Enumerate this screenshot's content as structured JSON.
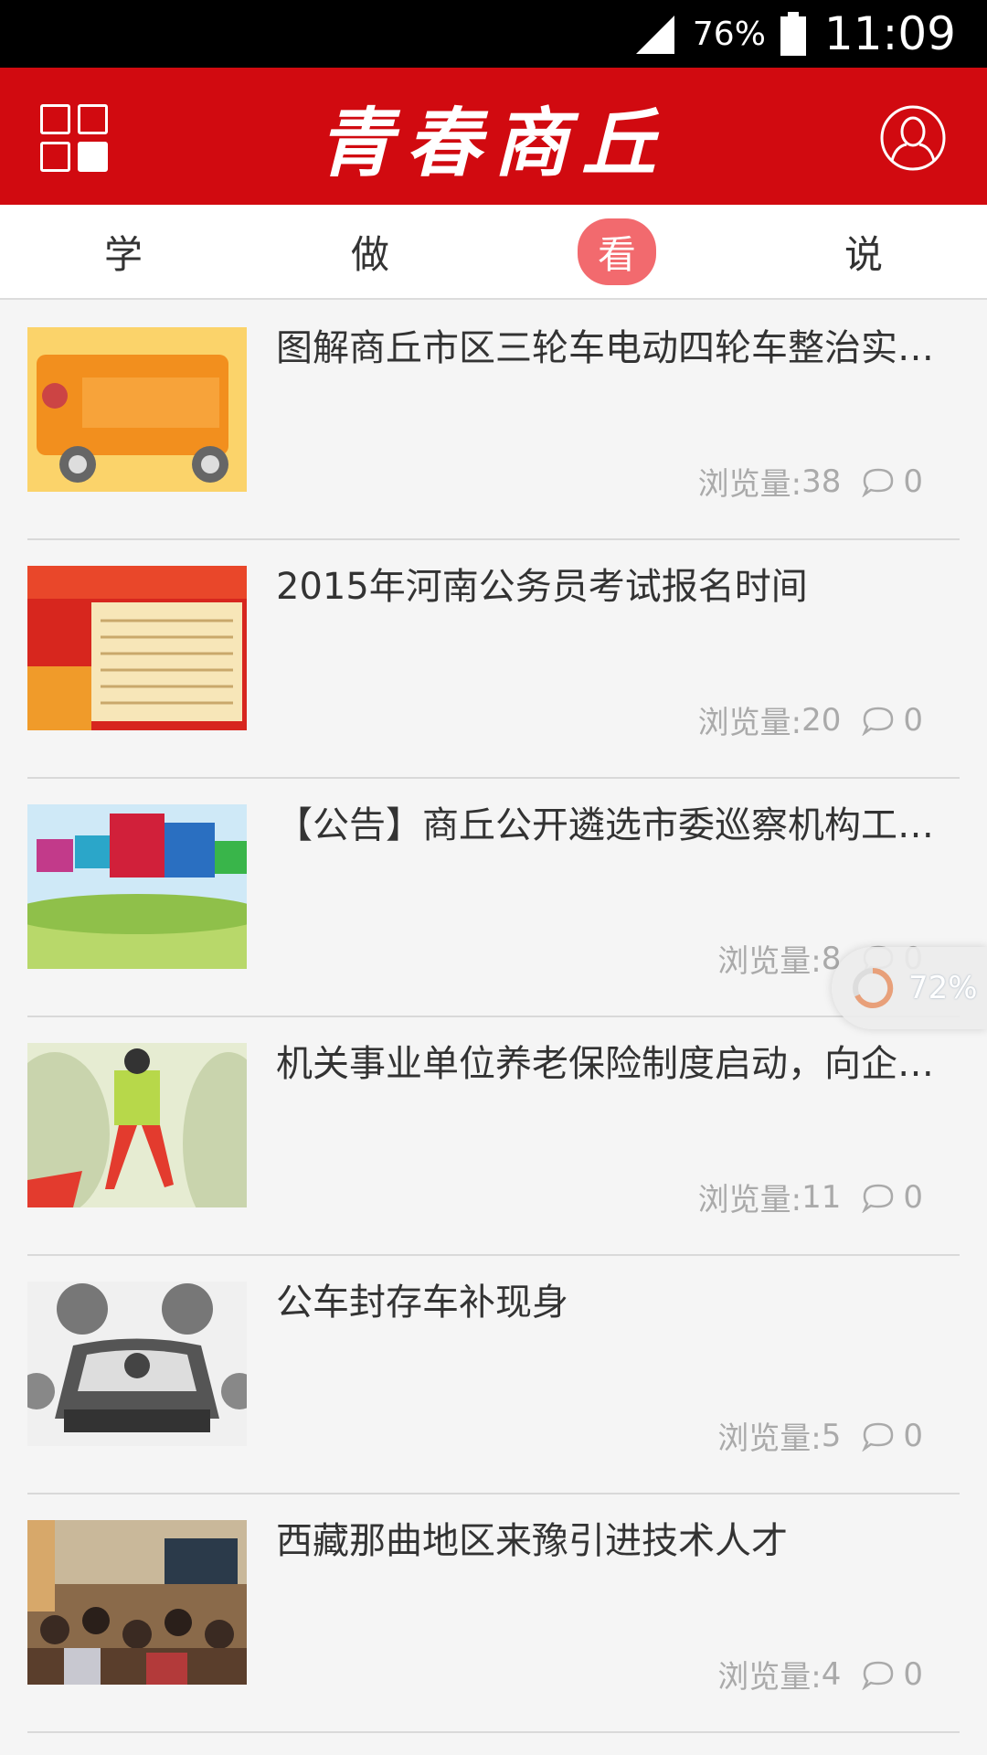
{
  "status_bar": {
    "battery": "76%",
    "time": "11:09"
  },
  "header": {
    "logo_text": "青春商丘"
  },
  "tabs": [
    {
      "label": "学",
      "active": false
    },
    {
      "label": "做",
      "active": false
    },
    {
      "label": "看",
      "active": true
    },
    {
      "label": "说",
      "active": false
    }
  ],
  "views_label": "浏览量:",
  "articles": [
    {
      "title": "图解商丘市区三轮车电动四轮车整治实施意见",
      "views": "38",
      "comments": "0",
      "image": "orange-truck-infographic"
    },
    {
      "title": "2015年河南公务员考试报名时间",
      "views": "20",
      "comments": "0",
      "image": "red-notice-poster"
    },
    {
      "title": "【公告】商丘公开遴选市委巡察机构工作人员",
      "views": "8",
      "comments": "0",
      "image": "registration-banner-field"
    },
    {
      "title": "机关事业单位养老保险制度启动，向企业职工看齐",
      "views": "11",
      "comments": "0",
      "image": "cartoon-figure-crossing"
    },
    {
      "title": "公车封存车补现身",
      "views": "5",
      "comments": "0",
      "image": "car-infographic"
    },
    {
      "title": "西藏那曲地区来豫引进技术人才",
      "views": "4",
      "comments": "0",
      "image": "lecture-hall-photo"
    }
  ],
  "float_loader": {
    "percent": "72%"
  },
  "colors": {
    "header_red": "#d10a10",
    "active_tab": "#f26a6e"
  }
}
